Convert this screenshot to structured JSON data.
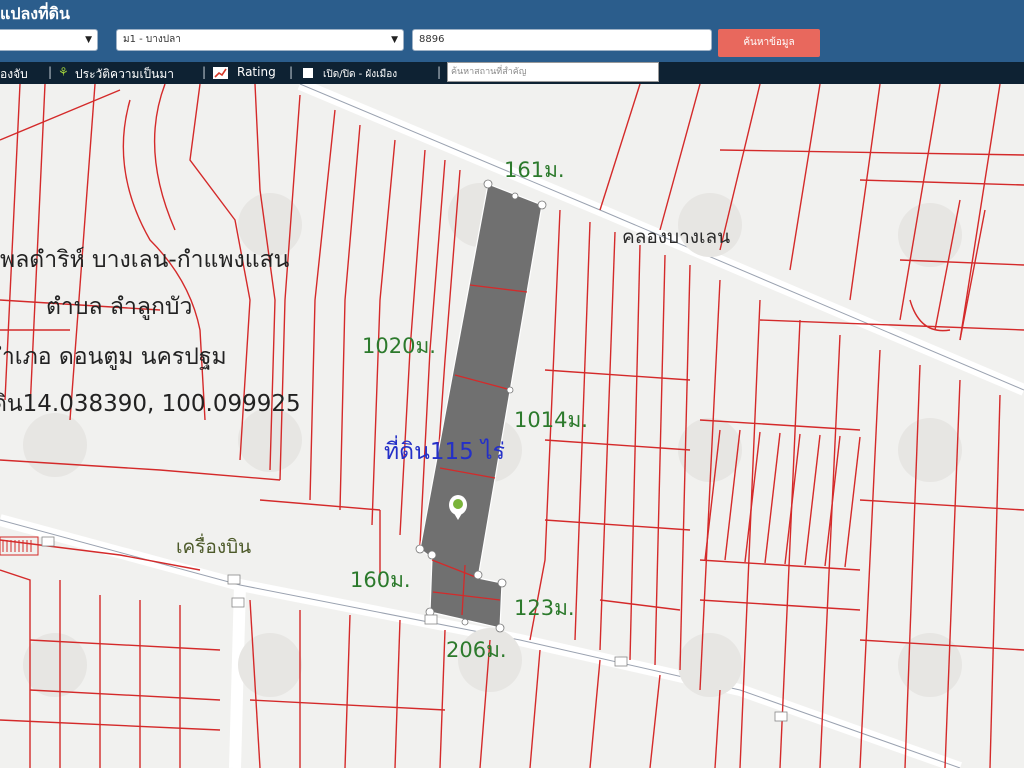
{
  "header": {
    "title": "แปลงที่ดิน",
    "district_select": "",
    "subdistrict_select": "ม1 - บางปลา",
    "parcel_number": "8896",
    "search_button": "ค้นหาข้อมูล"
  },
  "toolbar": {
    "item_partial": "องจับ",
    "history": "ประวัติความเป็นมา",
    "rating": "Rating",
    "toggle_plan": "เปิด/ปิด - ผังเมือง",
    "search_placeholder": "ค้นหาสถานที่สำคัญ"
  },
  "map": {
    "info_lines": [
      "ธพลดำริห์ บางเลน-กำแพงแสน",
      "ตำบล ลำลูกบัว",
      "อำเภอ ดอนตูม นครปฐม",
      "ดิน14.038390, 100.099925"
    ],
    "area_label": "ที่ดิน115 ไร่",
    "canal_label": "คลองบางเลน",
    "place_label": "เครื่องบิน",
    "measurements": {
      "north": "161ม.",
      "west": "1020ม.",
      "east": "1014ม.",
      "south_west": "160ม.",
      "south_east": "123ม.",
      "south": "206ม."
    }
  },
  "colors": {
    "header": "#2b5d8c",
    "toolbar": "#0e2233",
    "search_button": "#e8685d",
    "parcel_line": "#d42a2a",
    "selected_parcel": "#707070",
    "map_background": "#f1f1ef"
  }
}
